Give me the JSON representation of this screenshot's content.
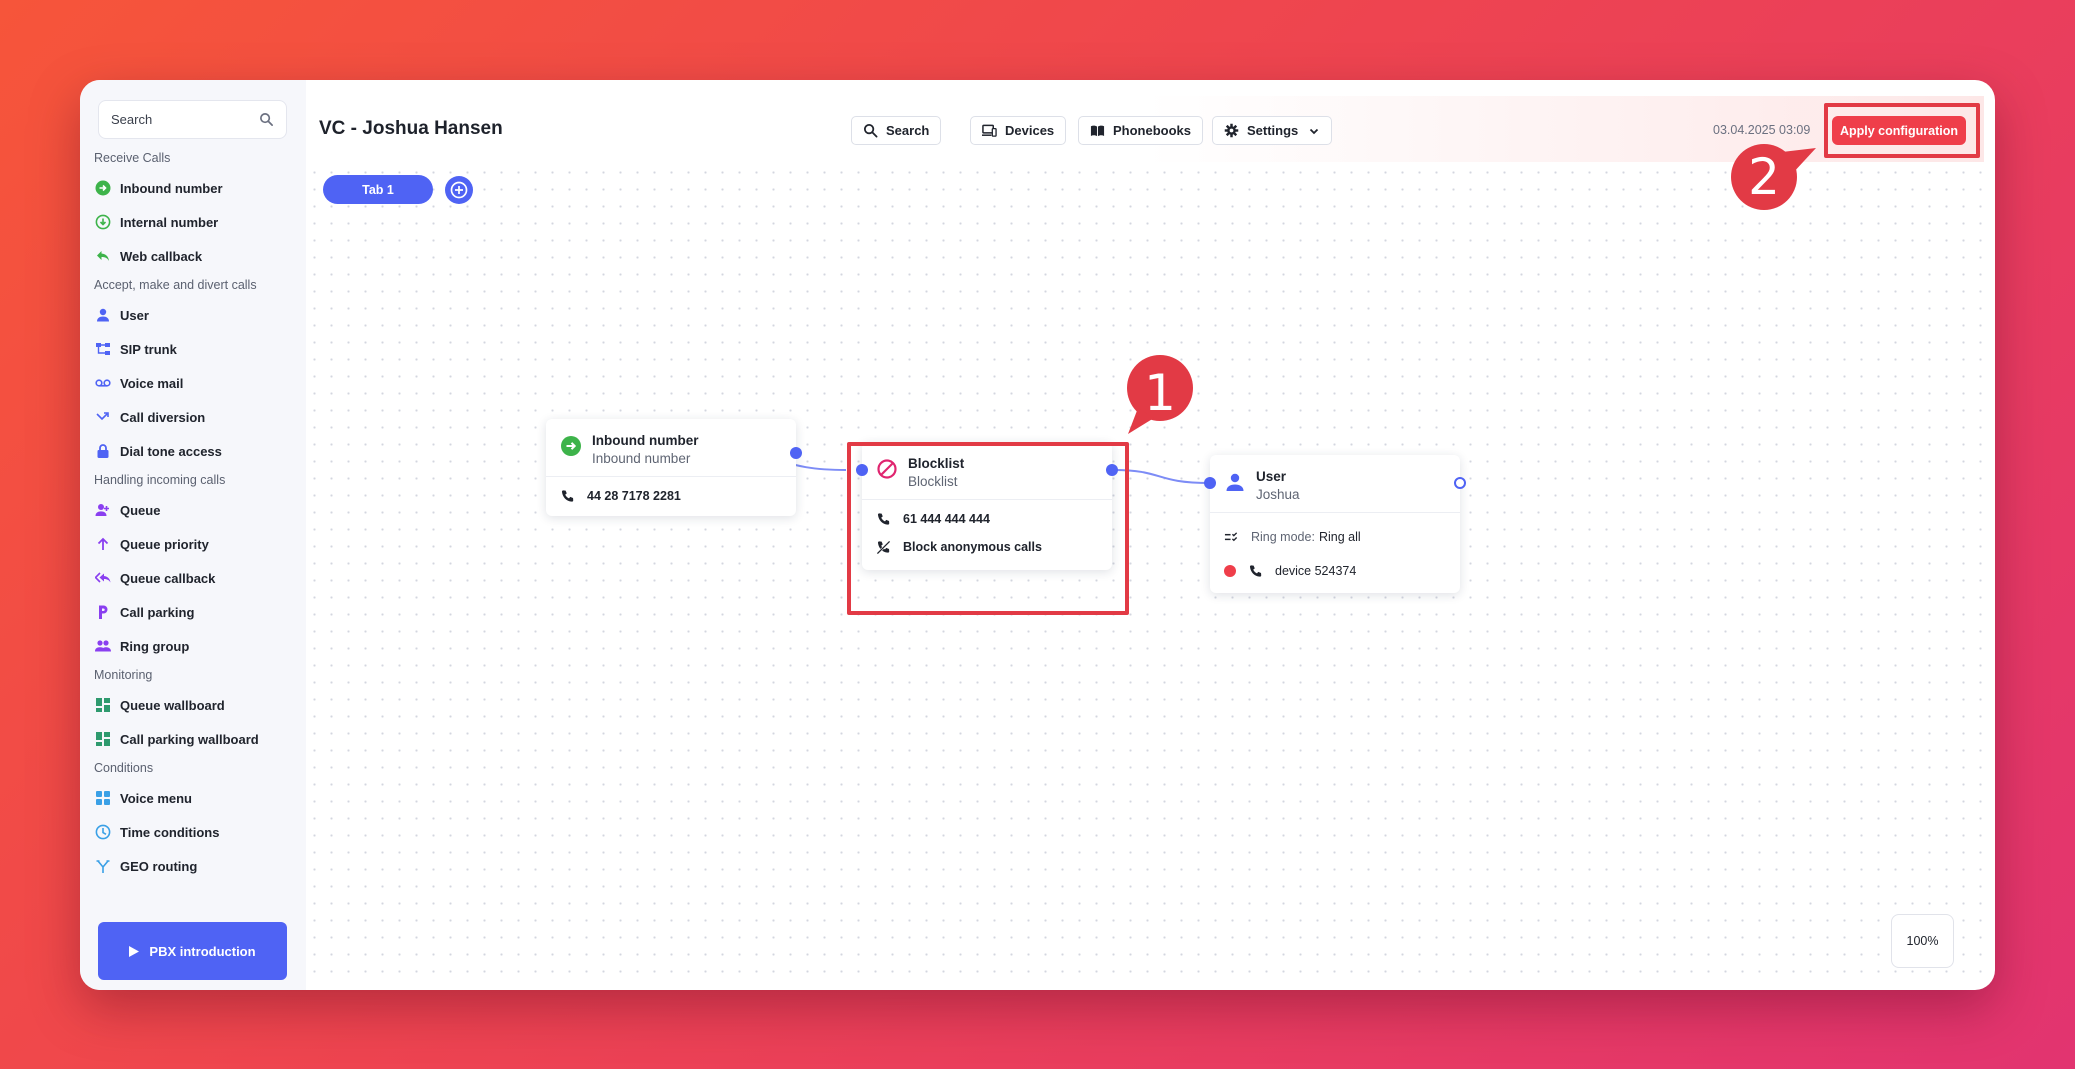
{
  "sidebar": {
    "search_placeholder": "Search",
    "sections": [
      {
        "title": "Receive Calls",
        "items": [
          {
            "label": "Inbound number",
            "icon": "inbound-number-icon"
          },
          {
            "label": "Internal number",
            "icon": "internal-number-icon"
          },
          {
            "label": "Web callback",
            "icon": "web-callback-icon"
          }
        ]
      },
      {
        "title": "Accept, make and divert calls",
        "items": [
          {
            "label": "User",
            "icon": "user-icon"
          },
          {
            "label": "SIP trunk",
            "icon": "sip-trunk-icon"
          },
          {
            "label": "Voice mail",
            "icon": "voicemail-icon"
          },
          {
            "label": "Call diversion",
            "icon": "call-diversion-icon"
          },
          {
            "label": "Dial tone access",
            "icon": "lock-icon"
          }
        ]
      },
      {
        "title": "Handling incoming calls",
        "items": [
          {
            "label": "Queue",
            "icon": "queue-icon"
          },
          {
            "label": "Queue priority",
            "icon": "arrow-up-icon"
          },
          {
            "label": "Queue callback",
            "icon": "reply-all-icon"
          },
          {
            "label": "Call parking",
            "icon": "parking-icon"
          },
          {
            "label": "Ring group",
            "icon": "group-icon"
          }
        ]
      },
      {
        "title": "Monitoring",
        "items": [
          {
            "label": "Queue wallboard",
            "icon": "dashboard-icon"
          },
          {
            "label": "Call parking wallboard",
            "icon": "dashboard-icon"
          }
        ]
      },
      {
        "title": "Conditions",
        "items": [
          {
            "label": "Voice menu",
            "icon": "grid-icon"
          },
          {
            "label": "Time conditions",
            "icon": "clock-icon"
          },
          {
            "label": "GEO routing",
            "icon": "fork-icon"
          }
        ]
      }
    ],
    "pbx_button": "PBX introduction"
  },
  "header": {
    "title": "VC - Joshua Hansen",
    "search_label": "Search",
    "devices_label": "Devices",
    "phonebooks_label": "Phonebooks",
    "settings_label": "Settings",
    "timestamp": "03.04.2025 03:09",
    "apply_label": "Apply configuration"
  },
  "tabs": {
    "tab1": "Tab 1"
  },
  "nodes": {
    "inbound": {
      "title": "Inbound number",
      "subtitle": "Inbound number",
      "number": "44 28 7178 2281"
    },
    "blocklist": {
      "title": "Blocklist",
      "subtitle": "Blocklist",
      "number": "61 444 444 444",
      "option": "Block anonymous calls"
    },
    "user": {
      "title": "User",
      "subtitle": "Joshua",
      "ring_mode_label": "Ring mode:",
      "ring_mode_value": "Ring all",
      "device": "device 524374"
    }
  },
  "zoom": "100%",
  "callouts": {
    "one": "1",
    "two": "2"
  },
  "colors": {
    "accent": "#4f63f4",
    "highlight": "#e23a45",
    "apply": "#ef3e4a"
  }
}
